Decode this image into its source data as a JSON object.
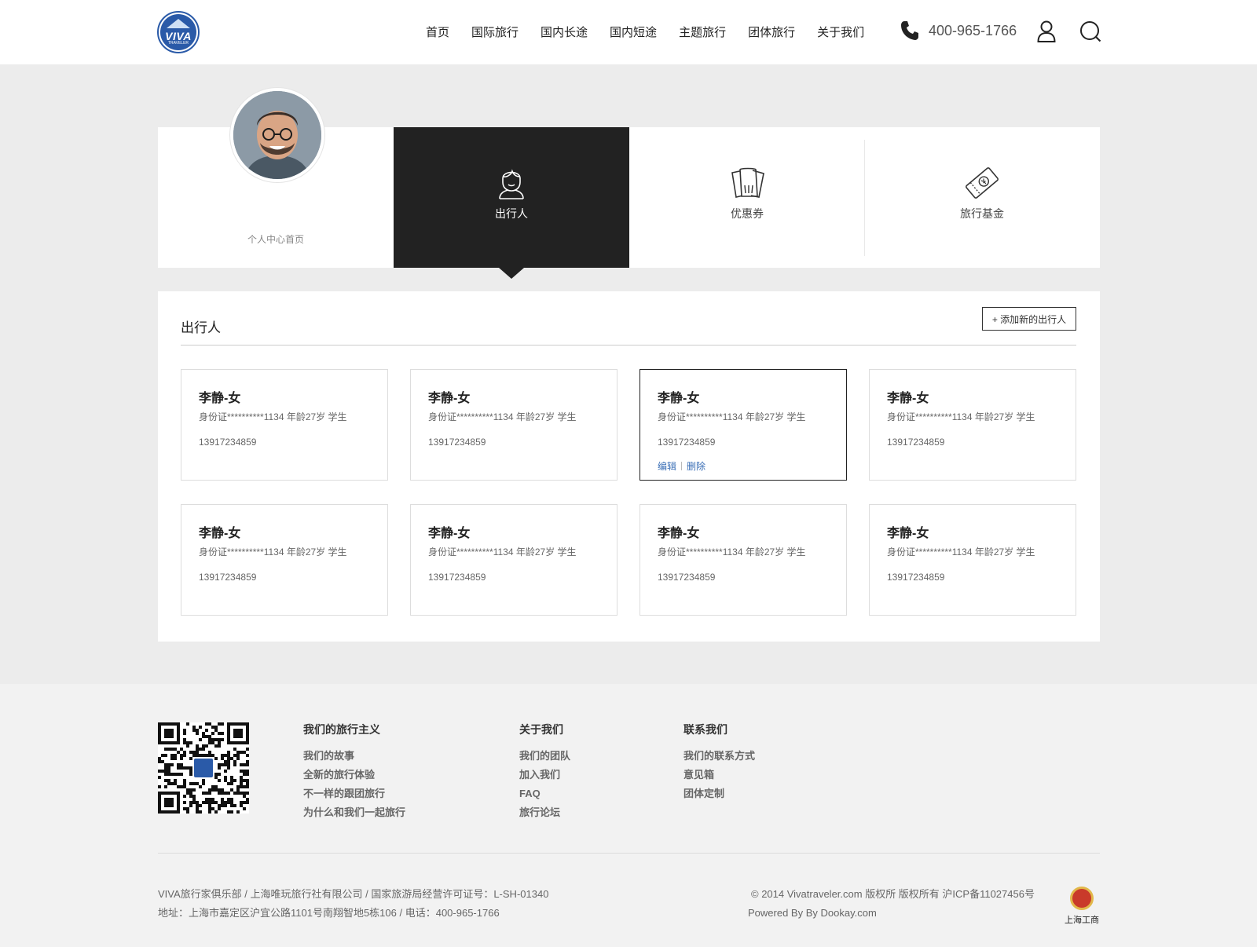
{
  "brand": {
    "logo_text": "VIVA",
    "logo_sub": "TRAVELER"
  },
  "nav": [
    "首页",
    "国际旅行",
    "国内长途",
    "国内短途",
    "主题旅行",
    "团体旅行",
    "关于我们"
  ],
  "header": {
    "phone": "400-965-1766"
  },
  "profile": {
    "home_label": "个人中心首页",
    "tabs": [
      {
        "label": "出行人",
        "icon": "traveler-icon",
        "active": true
      },
      {
        "label": "优惠券",
        "icon": "coupon-icon",
        "active": false
      },
      {
        "label": "旅行基金",
        "icon": "travel-fund-icon",
        "active": false
      }
    ]
  },
  "travelers": {
    "title": "出行人",
    "add_button": "+ 添加新的出行人",
    "edit_label": "编辑",
    "delete_label": "删除",
    "cards": [
      {
        "name": "李静-女",
        "info": "身份证**********1134  年龄27岁 学生",
        "phone": "13917234859",
        "selected": false
      },
      {
        "name": "李静-女",
        "info": "身份证**********1134  年龄27岁 学生",
        "phone": "13917234859",
        "selected": false
      },
      {
        "name": "李静-女",
        "info": "身份证**********1134  年龄27岁 学生",
        "phone": "13917234859",
        "selected": true
      },
      {
        "name": "李静-女",
        "info": "身份证**********1134  年龄27岁 学生",
        "phone": "13917234859",
        "selected": false
      },
      {
        "name": "李静-女",
        "info": "身份证**********1134  年龄27岁 学生",
        "phone": "13917234859",
        "selected": false
      },
      {
        "name": "李静-女",
        "info": "身份证**********1134  年龄27岁 学生",
        "phone": "13917234859",
        "selected": false
      },
      {
        "name": "李静-女",
        "info": "身份证**********1134  年龄27岁 学生",
        "phone": "13917234859",
        "selected": false
      },
      {
        "name": "李静-女",
        "info": "身份证**********1134  年龄27岁 学生",
        "phone": "13917234859",
        "selected": false
      }
    ]
  },
  "footer": {
    "columns": [
      {
        "heading": "我们的旅行主义",
        "links": [
          "我们的故事",
          "全新的旅行体验",
          "不一样的跟团旅行",
          "为什么和我们一起旅行"
        ]
      },
      {
        "heading": "关于我们",
        "links": [
          "我们的团队",
          "加入我们",
          "FAQ",
          "旅行论坛"
        ]
      },
      {
        "heading": "联系我们",
        "links": [
          "我们的联系方式",
          "意见箱",
          "团体定制"
        ]
      }
    ],
    "company_line": "VIVA旅行家俱乐部 / 上海唯玩旅行社有限公司 / 国家旅游局经营许可证号：L-SH-01340",
    "address_line": "地址：上海市嘉定区沪宜公路1101号南翔智地5栋106 / 电话：400-965-1766",
    "copyright_line": "© 2014 Vivatraveler.com 版权所 版权所有 沪ICP备11027456号",
    "powered_line": "Powered By By Dookay.com",
    "badge_label": "上海工商"
  }
}
